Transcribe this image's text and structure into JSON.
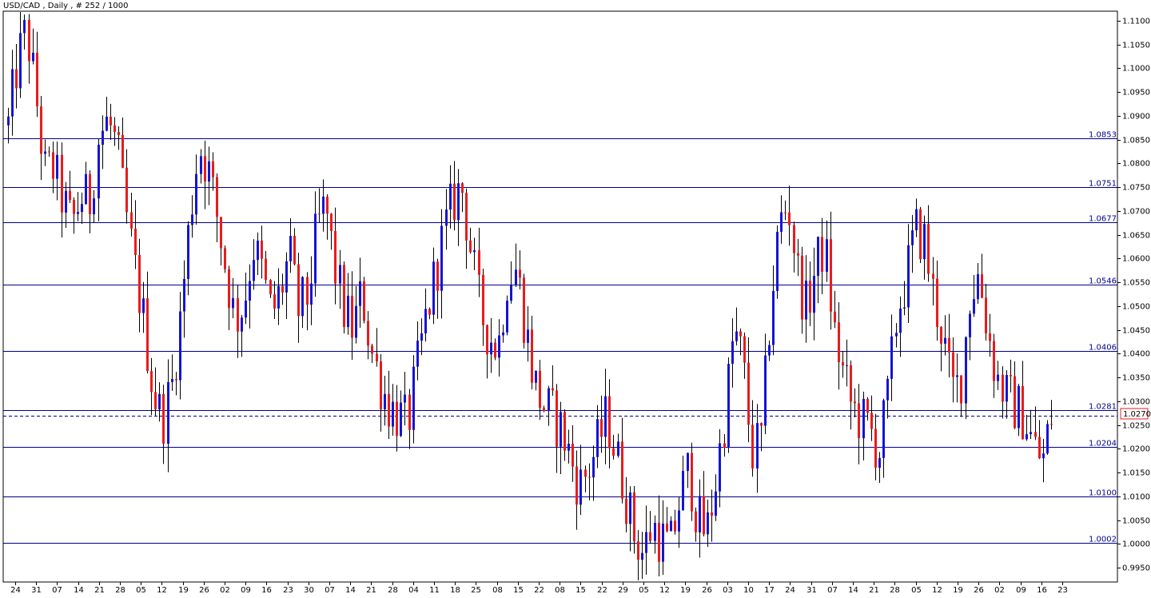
{
  "title": "USD/CAD , Daily , # 252 / 1000",
  "current_price": "1.0270",
  "colors": {
    "bull": "#1414d4",
    "bear": "#e81c1c",
    "level_line": "#00008b",
    "current_line": "#00008b",
    "current_box": "#e81c1c",
    "axis": "#000000",
    "background": "#ffffff"
  },
  "chart_data": {
    "type": "candlestick",
    "title": "USD/CAD , Daily , # 252 / 1000",
    "ylim": [
      0.992,
      1.112
    ],
    "grid": false,
    "y_ticks": [
      "1.1100",
      "1.1050",
      "1.1000",
      "1.0950",
      "1.0900",
      "1.0850",
      "1.0800",
      "1.0750",
      "1.0700",
      "1.0650",
      "1.0600",
      "1.0550",
      "1.0500",
      "1.0450",
      "1.0400",
      "1.0350",
      "1.0300",
      "1.0250",
      "1.0200",
      "1.0150",
      "1.0100",
      "1.0050",
      "1.0000",
      "0.9950"
    ],
    "x_ticks": [
      "24",
      "31",
      "07",
      "14",
      "21",
      "28",
      "05",
      "12",
      "19",
      "26",
      "02",
      "09",
      "16",
      "23",
      "30",
      "07",
      "14",
      "21",
      "28",
      "04",
      "11",
      "18",
      "25",
      "08",
      "15",
      "22",
      "08",
      "15",
      "22",
      "29",
      "05",
      "12",
      "19",
      "26",
      "03",
      "10",
      "17",
      "24",
      "31",
      "07",
      "14",
      "21",
      "28",
      "05",
      "12",
      "19",
      "26",
      "02",
      "09",
      "16",
      "23"
    ],
    "horizontal_levels": [
      "1.0853",
      "1.0751",
      "1.0677",
      "1.0546",
      "1.0406",
      "1.0281",
      "1.0204",
      "1.0100",
      "1.0002"
    ],
    "current_price": 1.027,
    "price_path": [
      1.088,
      1.101,
      1.108,
      1.095,
      1.078,
      1.079,
      1.072,
      1.067,
      1.073,
      1.072,
      1.086,
      1.089,
      1.083,
      1.069,
      1.057,
      1.046,
      1.032,
      1.026,
      1.033,
      1.048,
      1.068,
      1.084,
      1.079,
      1.069,
      1.058,
      1.047,
      1.051,
      1.063,
      1.057,
      1.048,
      1.053,
      1.061,
      1.049,
      1.052,
      1.066,
      1.071,
      1.058,
      1.049,
      1.045,
      1.053,
      1.041,
      1.034,
      1.029,
      1.027,
      1.025,
      1.036,
      1.047,
      1.056,
      1.065,
      1.072,
      1.075,
      1.062,
      1.049,
      1.044,
      1.041,
      1.056,
      1.058,
      1.046,
      1.034,
      1.029,
      1.027,
      1.024,
      1.018,
      1.012,
      1.016,
      1.021,
      1.027,
      1.019,
      1.011,
      1.002,
      0.998,
      1.004,
      1.001,
      0.999,
      1.009,
      1.016,
      1.005,
      1.002,
      1.013,
      1.027,
      1.045,
      1.038,
      1.019,
      1.022,
      1.049,
      1.067,
      1.072,
      1.057,
      1.049,
      1.058,
      1.063,
      1.045,
      1.036,
      1.029,
      1.026,
      1.024,
      1.019,
      1.031,
      1.049,
      1.056,
      1.066,
      1.064,
      1.052,
      1.044,
      1.032,
      1.034,
      1.052,
      1.057,
      1.045,
      1.035,
      1.031,
      1.029,
      1.027,
      1.021,
      1.017,
      1.027
    ]
  }
}
